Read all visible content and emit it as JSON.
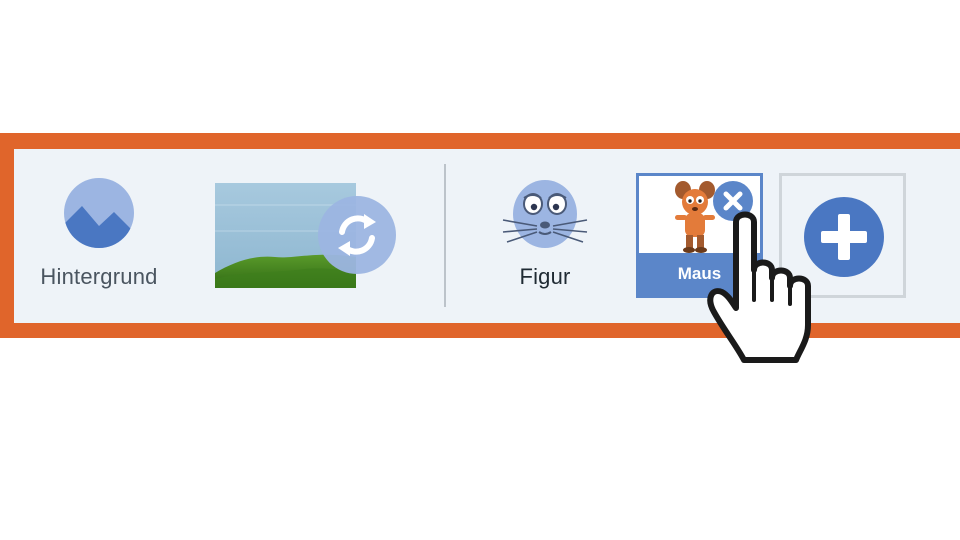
{
  "toolbar": {
    "background_tool": {
      "label": "Hintergrund",
      "icon": "landscape-icon"
    },
    "background_preview": {
      "icon": "meadow-image"
    },
    "refresh_button": {
      "icon": "refresh-icon"
    },
    "figure_tool": {
      "label": "Figur",
      "icon": "mouse-face-icon"
    },
    "selected_character": {
      "name": "Maus",
      "icon": "mouse-character-image"
    },
    "remove_button": {
      "icon": "close-icon"
    },
    "add_button": {
      "icon": "plus-icon"
    }
  },
  "cursor": {
    "icon": "hand-pointer-icon"
  },
  "colors": {
    "frame": "#e0652b",
    "toolbar_bg": "#eef3f8",
    "accent_blue": "#5b86c9",
    "icon_light_blue": "#9cb5e2",
    "divider": "#bcc3ca"
  }
}
